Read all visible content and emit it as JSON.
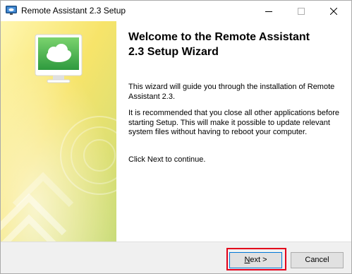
{
  "window": {
    "title": "Remote Assistant 2.3 Setup",
    "controls": {
      "minimize": "—",
      "maximize": "☐",
      "close": "✕"
    }
  },
  "welcome": {
    "heading_line1": "Welcome to the Remote Assistant",
    "heading_line2": "2.3 Setup Wizard",
    "paragraph1": "This wizard will guide you through the installation of Remote Assistant 2.3.",
    "paragraph2": "It is recommended that you close all other applications before starting Setup. This will make it possible to update relevant system files without having to reboot your computer.",
    "paragraph3": "Click Next to continue."
  },
  "buttons": {
    "next_prefix": "",
    "next_mnemonic": "N",
    "next_rest": "ext >",
    "cancel": "Cancel"
  },
  "colors": {
    "highlight": "#e3001b",
    "banner_yellow": "#f4e15a",
    "banner_green": "#b6d36a",
    "monitor_green": "#4caf50"
  },
  "icons": {
    "app": "monitor-cloud-icon",
    "banner": "monitor-cloud-illustration"
  }
}
